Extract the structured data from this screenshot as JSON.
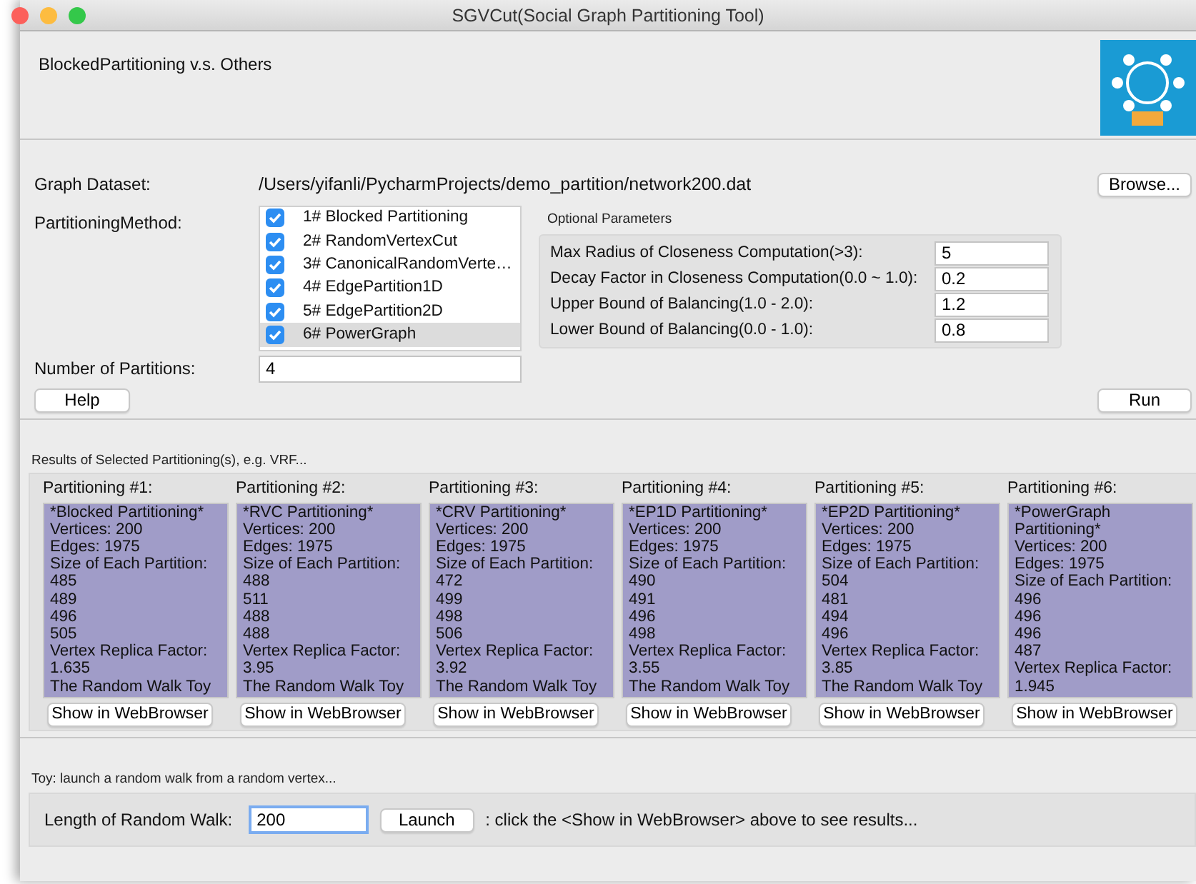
{
  "window": {
    "title": "SGVCut(Social Graph Partitioning Tool)"
  },
  "header": {
    "title": "BlockedPartitioning v.s. Others"
  },
  "dataset": {
    "label": "Graph Dataset:",
    "path": "/Users/yifanli/PycharmProjects/demo_partition/network200.dat",
    "button": "Browse..."
  },
  "method": {
    "label": "PartitioningMethod:",
    "items": [
      {
        "label": "1# Blocked Partitioning",
        "checked": true,
        "selected": false
      },
      {
        "label": "2# RandomVertexCut",
        "checked": true,
        "selected": false
      },
      {
        "label": "3# CanonicalRandomVerte…",
        "checked": true,
        "selected": false
      },
      {
        "label": "4# EdgePartition1D",
        "checked": true,
        "selected": false
      },
      {
        "label": "5# EdgePartition2D",
        "checked": true,
        "selected": false
      },
      {
        "label": "6# PowerGraph",
        "checked": true,
        "selected": true
      }
    ]
  },
  "optional_parameters": {
    "title": "Optional Parameters",
    "params": [
      {
        "label": "Max Radius of Closeness Computation(>3):",
        "value": "5"
      },
      {
        "label": "Decay Factor in Closeness Computation(0.0 ~ 1.0):",
        "value": "0.2"
      },
      {
        "label": "Upper Bound of Balancing(1.0 - 2.0):",
        "value": "1.2"
      },
      {
        "label": "Lower Bound of Balancing(0.0 - 1.0):",
        "value": "0.8"
      }
    ]
  },
  "partitions": {
    "label": "Number of Partitions:",
    "value": "4"
  },
  "buttons": {
    "help": "Help",
    "run": "Run"
  },
  "results": {
    "title": "Results of Selected Partitioning(s), e.g. VRF...",
    "columns": [
      {
        "header": "Partitioning #1:",
        "lines": [
          "*Blocked Partitioning*",
          "Vertices: 200",
          "Edges: 1975",
          "Size of Each Partition:",
          "485",
          "489",
          "496",
          "505",
          "Vertex Replica Factor:",
          "1.635",
          "The Random Walk Toy"
        ],
        "button": "Show in WebBrowser"
      },
      {
        "header": "Partitioning #2:",
        "lines": [
          "*RVC Partitioning*",
          "Vertices: 200",
          "Edges: 1975",
          "Size of Each Partition:",
          "488",
          "511",
          "488",
          "488",
          "Vertex Replica Factor:",
          "3.95",
          "The Random Walk Toy"
        ],
        "button": "Show in WebBrowser"
      },
      {
        "header": "Partitioning #3:",
        "lines": [
          "*CRV Partitioning*",
          "Vertices: 200",
          "Edges: 1975",
          "Size of Each Partition:",
          "472",
          "499",
          "498",
          "506",
          "Vertex Replica Factor:",
          "3.92",
          "The Random Walk Toy"
        ],
        "button": "Show in WebBrowser"
      },
      {
        "header": "Partitioning #4:",
        "lines": [
          "*EP1D Partitioning*",
          "Vertices: 200",
          "Edges: 1975",
          "Size of Each Partition:",
          "490",
          "491",
          "496",
          "498",
          "Vertex Replica Factor:",
          "3.55",
          "The Random Walk Toy"
        ],
        "button": "Show in WebBrowser"
      },
      {
        "header": "Partitioning #5:",
        "lines": [
          "*EP2D Partitioning*",
          "Vertices: 200",
          "Edges: 1975",
          "Size of Each Partition:",
          "504",
          "481",
          "494",
          "496",
          "Vertex Replica Factor:",
          "3.85",
          "The Random Walk Toy"
        ],
        "button": "Show in WebBrowser"
      },
      {
        "header": "Partitioning #6:",
        "lines": [
          "*PowerGraph Partitioning*",
          "Vertices: 200",
          "Edges: 1975",
          "Size of Each Partition:",
          "496",
          "496",
          "496",
          "487",
          "Vertex Replica Factor:",
          "1.945"
        ],
        "button": "Show in WebBrowser"
      }
    ]
  },
  "toy": {
    "title": "Toy: launch a random walk from a random vertex...",
    "label": "Length of Random Walk:",
    "value": "200",
    "button": "Launch",
    "hint": ": click the <Show in WebBrowser> above to see results..."
  }
}
